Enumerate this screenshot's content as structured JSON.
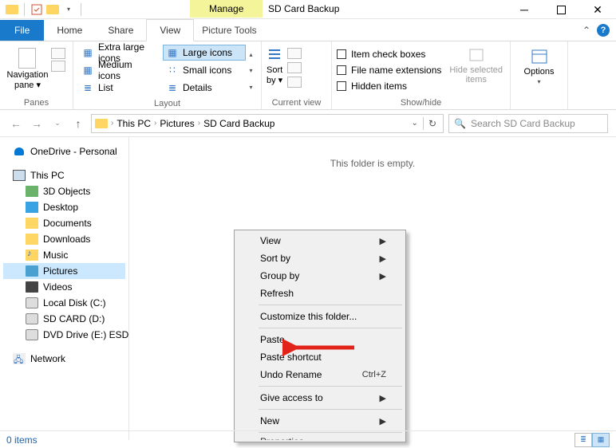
{
  "title": "SD Card Backup",
  "contextual_tab": {
    "manage": "Manage",
    "tool": "Picture Tools"
  },
  "tabs": {
    "file": "File",
    "home": "Home",
    "share": "Share",
    "view": "View"
  },
  "ribbon": {
    "panes_label": "Panes",
    "nav_pane": "Navigation\npane ▾",
    "layout_label": "Layout",
    "layout": {
      "extra_large": "Extra large icons",
      "large": "Large icons",
      "medium": "Medium icons",
      "small": "Small icons",
      "list": "List",
      "details": "Details"
    },
    "current_view_label": "Current view",
    "sort_by": "Sort\nby ▾",
    "show_hide_label": "Show/hide",
    "item_check": "Item check boxes",
    "file_ext": "File name extensions",
    "hidden": "Hidden items",
    "hide_selected": "Hide selected\nitems",
    "options": "Options"
  },
  "breadcrumb": [
    "This PC",
    "Pictures",
    "SD Card Backup"
  ],
  "search_placeholder": "Search SD Card Backup",
  "tree": {
    "onedrive": "OneDrive - Personal",
    "thispc": "This PC",
    "objects3d": "3D Objects",
    "desktop": "Desktop",
    "documents": "Documents",
    "downloads": "Downloads",
    "music": "Music",
    "pictures": "Pictures",
    "videos": "Videos",
    "localdisk": "Local Disk (C:)",
    "sdcard": "SD CARD (D:)",
    "dvd": "DVD Drive (E:) ESD-IS",
    "network": "Network"
  },
  "empty": "This folder is empty.",
  "context": {
    "view": "View",
    "sortby": "Sort by",
    "groupby": "Group by",
    "refresh": "Refresh",
    "customize": "Customize this folder...",
    "paste": "Paste",
    "paste_shortcut": "Paste shortcut",
    "undo_rename": "Undo Rename",
    "undo_key": "Ctrl+Z",
    "give_access": "Give access to",
    "new": "New",
    "properties": "Properties"
  },
  "status": {
    "items": "0 items"
  }
}
